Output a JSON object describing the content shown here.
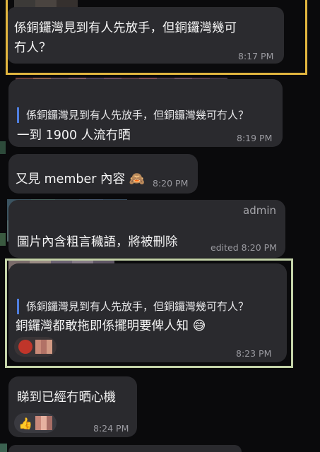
{
  "messages": [
    {
      "id": "m1",
      "text_line1": "係銅鑼灣見到有人先放手，但銅鑼灣幾可",
      "text_line2": "冇人？",
      "time": "8:17 PM"
    },
    {
      "id": "m2",
      "quote": "係銅鑼灣見到有人先放手，但銅鑼灣幾可冇人？",
      "text": "一到 1900 人流冇晒",
      "time": "8:19 PM"
    },
    {
      "id": "m3",
      "text": "又見 member 內容",
      "emoji": "🙈",
      "time": "8:20 PM"
    },
    {
      "id": "m4",
      "sender": "admin",
      "text": "圖片內含粗言穢語，將被刪除",
      "time": "edited 8:20 PM"
    },
    {
      "id": "m5",
      "quote": "係銅鑼灣見到有人先放手，但銅鑼灣幾可冇人？",
      "text": "銅鑼灣都敢拖即係擺明要俾人知",
      "emoji": "😅",
      "time": "8:23 PM"
    },
    {
      "id": "m6",
      "text": "睇到已經冇晒心機",
      "reaction_emoji": "👍",
      "time": "8:24 PM"
    }
  ],
  "colors": {
    "background": "#0a0a0c",
    "bubble": "#2a2a2e",
    "quote_bar": "#4f7fe0",
    "highlight_yellow": "#e2b63f",
    "highlight_green": "#c4d3a9"
  }
}
